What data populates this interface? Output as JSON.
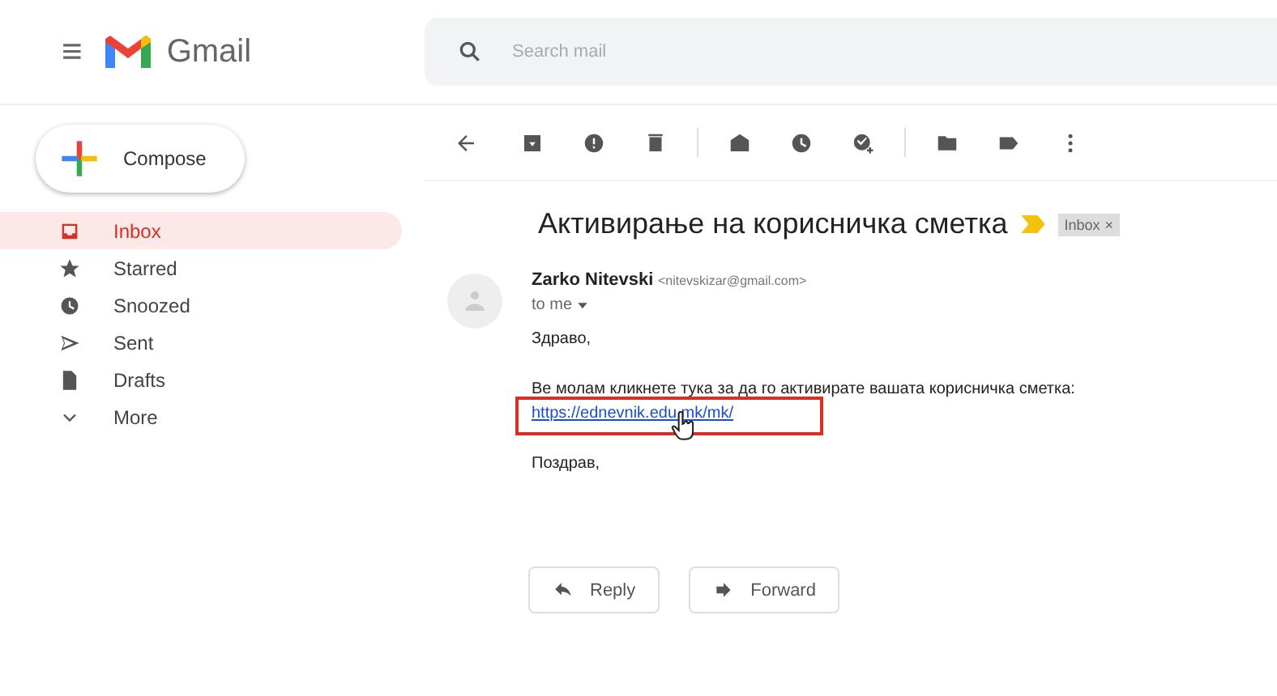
{
  "header": {
    "menu_icon": "≡",
    "app_name": "Gmail",
    "search": {
      "placeholder": "Search mail"
    }
  },
  "compose": {
    "label": "Compose"
  },
  "sidebar": {
    "items": [
      {
        "label": "Inbox",
        "selected": true
      },
      {
        "label": "Starred",
        "selected": false
      },
      {
        "label": "Snoozed",
        "selected": false
      },
      {
        "label": "Sent",
        "selected": false
      },
      {
        "label": "Drafts",
        "selected": false
      },
      {
        "label": "More",
        "selected": false
      }
    ]
  },
  "message": {
    "subject": "Активирање на корисничка сметка",
    "label": {
      "text": "Inbox",
      "close": "×"
    },
    "sender_name": "Zarko Nitevski",
    "sender_email": "<nitevskizar@gmail.com>",
    "recipient": "to me",
    "greeting": "Здраво,",
    "body": "Ве молам кликнете тука за да го активирате вашата корисничка сметка:",
    "link": "https://ednevnik.edu.mk/mk/",
    "link_highlighted": true,
    "signoff": "Поздрав,"
  },
  "actions": [
    {
      "label": "Reply"
    },
    {
      "label": "Forward"
    }
  ]
}
